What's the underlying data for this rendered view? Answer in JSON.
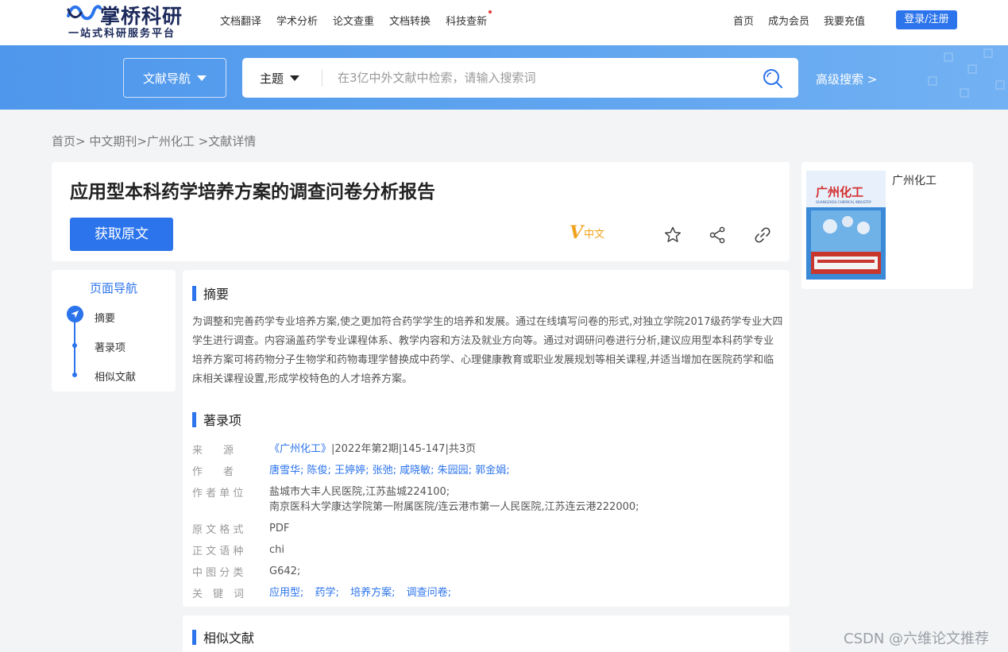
{
  "header": {
    "logo_text": "掌桥科研",
    "logo_slogan": "一站式科研服务平台",
    "nav_items": [
      {
        "label": "文档翻译"
      },
      {
        "label": "学术分析"
      },
      {
        "label": "论文查重"
      },
      {
        "label": "文档转换"
      },
      {
        "label": "科技查新"
      }
    ],
    "right_items": [
      {
        "label": "首页"
      },
      {
        "label": "成为会员"
      },
      {
        "label": "我要充值"
      }
    ],
    "login_label": "登录/注册"
  },
  "search": {
    "doc_nav_label": "文献导航",
    "type_label": "主题",
    "placeholder": "在3亿中外文献中检索，请输入搜索词",
    "advanced_label": "高级搜索 >"
  },
  "breadcrumb": "首页> 中文期刊>广州化工 >文献详情",
  "document": {
    "title": "应用型本科药学培养方案的调查问卷分析报告",
    "get_original_label": "获取原文",
    "lang_mark": "V",
    "lang_label": "中文"
  },
  "journal": {
    "name": "广州化工",
    "cover_title": "广州化工",
    "cover_subtitle": "GUANGZHOU CHEMICAL INDUSTRY"
  },
  "page_nav": {
    "title": "页面导航",
    "items": [
      {
        "label": "摘要"
      },
      {
        "label": "著录项"
      },
      {
        "label": "相似文献"
      }
    ]
  },
  "abstract": {
    "heading": "摘要",
    "text": "为调整和完善药学专业培养方案,使之更加符合药学学生的培养和发展。通过在线填写问卷的形式,对独立学院2017级药学专业大四学生进行调查。内容涵盖药学专业课程体系、教学内容和方法及就业方向等。通过对调研问卷进行分析,建议应用型本科药学专业培养方案可将药物分子生物学和药物毒理学替换成中药学、心理健康教育或职业发展规划等相关课程,并适当增加在医院药学和临床相关课程设置,形成学校特色的人才培养方案。"
  },
  "record": {
    "heading": "著录项",
    "source_label": "来　　源",
    "source_link": "《广州化工》",
    "source_rest": "|2022年第2期|145-147|共3页",
    "author_label": "作　　者",
    "authors": [
      "唐雪华;",
      "陈俊;",
      "王婷婷;",
      "张弛;",
      "咸晓敏;",
      "朱园园;",
      "郭金娟;"
    ],
    "affiliation_label": "作 者 单 位",
    "affiliation_line1": "盐城市大丰人民医院,江苏盐城224100;",
    "affiliation_line2": "南京医科大学康达学院第一附属医院/连云港市第一人民医院,江苏连云港222000;",
    "format_label": "原 文 格 式",
    "format_value": "PDF",
    "language_label": "正 文 语 种",
    "language_value": "chi",
    "clc_label": "中 图 分 类",
    "clc_value": "G642;",
    "keywords_label": "关　键　词",
    "keywords": [
      "应用型;",
      "药学;",
      "培养方案;",
      "调查问卷;"
    ]
  },
  "similar": {
    "heading": "相似文献"
  },
  "watermark": "CSDN @六维论文推荐",
  "colors": {
    "accent": "#2c74ec",
    "band": "#5da3ef",
    "lang_badge": "#f0a21d"
  }
}
